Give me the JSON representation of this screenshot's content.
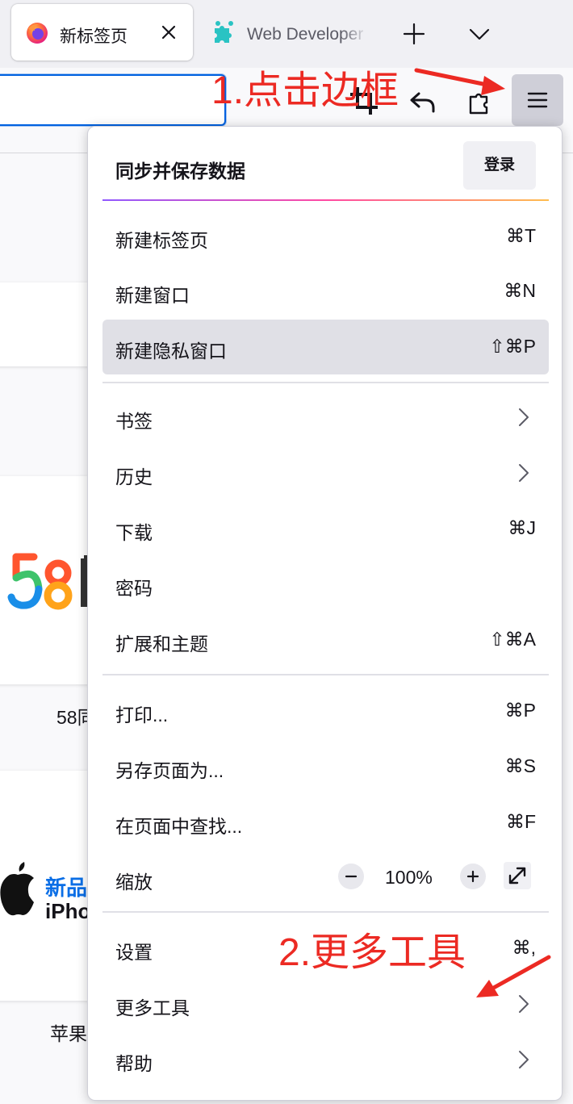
{
  "tabs": {
    "active": {
      "label": "新标签页",
      "icon": "firefox-icon"
    },
    "inactive": {
      "label": "Web Developer",
      "icon": "puzzle-icon"
    },
    "new_tab_icon": "plus-icon",
    "list_tabs_icon": "chevron-down-icon"
  },
  "toolbar": {
    "icons": [
      "crop-icon",
      "undo-icon",
      "extensions-icon",
      "hamburger-menu-icon"
    ]
  },
  "background": {
    "site1_label": "58同",
    "site2_label": "苹果",
    "apple_line1": "新品",
    "apple_line2": "iPho"
  },
  "menu": {
    "header": {
      "title": "同步并保存数据",
      "signin_label": "登录"
    },
    "group1": [
      {
        "label": "新建标签页",
        "shortcut": "⌘T"
      },
      {
        "label": "新建窗口",
        "shortcut": "⌘N"
      },
      {
        "label": "新建隐私窗口",
        "shortcut": "⇧⌘P",
        "hovered": true
      }
    ],
    "group2": [
      {
        "label": "书签",
        "submenu": true
      },
      {
        "label": "历史",
        "submenu": true
      },
      {
        "label": "下载",
        "shortcut": "⌘J"
      },
      {
        "label": "密码"
      },
      {
        "label": "扩展和主题",
        "shortcut": "⇧⌘A"
      }
    ],
    "group3": [
      {
        "label": "打印...",
        "shortcut": "⌘P"
      },
      {
        "label": "另存页面为...",
        "shortcut": "⌘S"
      },
      {
        "label": "在页面中查找...",
        "shortcut": "⌘F"
      }
    ],
    "zoom": {
      "label": "缩放",
      "value": "100%",
      "minus": "−",
      "plus": "+",
      "fullscreen_icon": "fullscreen-icon"
    },
    "group4": [
      {
        "label": "设置",
        "shortcut": "⌘,"
      },
      {
        "label": "更多工具",
        "submenu": true
      },
      {
        "label": "帮助",
        "submenu": true
      }
    ]
  },
  "annotations": {
    "step1": "1.点击边框",
    "step2": "2.更多工具",
    "color": "#ec2a23"
  },
  "colors": {
    "accent": "#0061e0",
    "menu_hover": "#e0e0e6",
    "gradient": [
      "#9059ff",
      "#ff4aa2",
      "#ffbd4f"
    ]
  }
}
